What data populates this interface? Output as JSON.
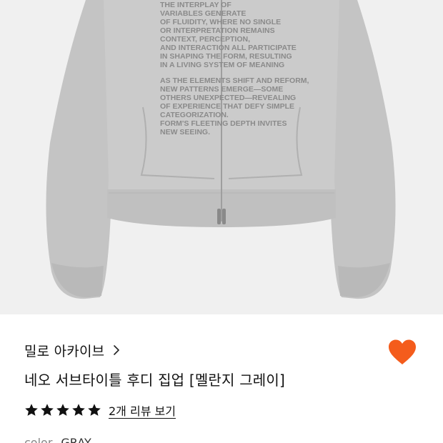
{
  "product_image": {
    "icon": "hoodie-photo"
  },
  "brand": {
    "name": "밀로 아카이브",
    "icon": "chevron-right-icon"
  },
  "wishlist": {
    "icon": "heart-icon",
    "active": true,
    "color": "#f45c1c"
  },
  "product": {
    "title": "네오 서브타이틀 후디 집업 [멜란지 그레이]"
  },
  "rating": {
    "stars": 5,
    "max": 5,
    "review_link": "2개 리뷰 보기"
  },
  "option": {
    "label": "color",
    "value": "GRAY"
  },
  "print_lines": [
    "THE INTERPLAY OF",
    "VARIABLES GENERATE",
    "OF FLUIDITY, WHERE NO SINGLE",
    "OR INTERPRETATION REMAINS",
    "CONTEXT, PERCEPTION,",
    "AND INTERACTION ALL PARTICIPATE",
    "IN SHAPING THE FORM, RESULTING",
    "IN A LIVING SYSTEM OF MEANING",
    "AS THE ELEMENTS SHIFT AND REFORM,",
    "NEW PATTERNS EMERGE—SOME",
    "OTHERS UNEXPECTED—REVEALING",
    "OF EXPERIENCE THAT DEFY SIMPLE",
    "CATEGORIZATION.",
    "FORM'S FLEETING DEPTH INVITES",
    "NEW SEEING."
  ],
  "colors": {
    "accent": "#f45c1c",
    "image_bg": "#f0f0f0",
    "garment": "#c9c9c9"
  }
}
